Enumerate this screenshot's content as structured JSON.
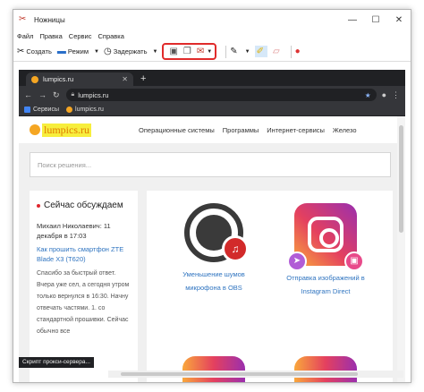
{
  "window": {
    "title": "Ножницы",
    "controls": {
      "minimize": "—",
      "maximize": "☐",
      "close": "✕"
    }
  },
  "menu": [
    "Файл",
    "Правка",
    "Сервис",
    "Справка"
  ],
  "toolbar": {
    "create_label": "Создать",
    "mode_label": "Режим",
    "delay_label": "Задержать",
    "highlight_color": "#e02b2b"
  },
  "browser": {
    "tab_title": "lumpics.ru",
    "new_tab": "+",
    "url": "lumpics.ru",
    "bookmarks": [
      "Сервисы",
      "lumpics.ru"
    ],
    "status_text": "Скрипт прокси-сервера..."
  },
  "site": {
    "logo_text": "lumpics.ru",
    "nav": [
      "Операционные системы",
      "Программы",
      "Интернет-сервисы",
      "Железо"
    ],
    "search_placeholder": "Поиск решения...",
    "discussion": {
      "title": "Сейчас обсуждаем",
      "author": "Михаил Николаевич: 11 декабря в 17:03",
      "link": "Как прошить смартфон ZTE Blade X3 (T620)",
      "body": "Спасибо за быстрый ответ. Вчера уже сел, а сегодня утром только вернулся в 16:30. Начну отвечать частями. 1. со стандартной прошивки. Сейчас обычно все"
    },
    "cards": [
      {
        "caption": "Уменьшение шумов микрофона в OBS"
      },
      {
        "caption": "Отправка изображений в Instagram Direct"
      }
    ]
  }
}
